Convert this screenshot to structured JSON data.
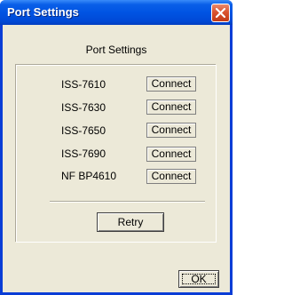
{
  "window": {
    "title": "Port Settings"
  },
  "dialog": {
    "heading": "Port Settings",
    "ports": [
      {
        "name": "ISS-7610",
        "status": "Connect"
      },
      {
        "name": "ISS-7630",
        "status": "Connect"
      },
      {
        "name": "ISS-7650",
        "status": "Connect"
      },
      {
        "name": "ISS-7690",
        "status": "Connect"
      },
      {
        "name": "NF BP4610",
        "status": "Connect"
      }
    ],
    "retry_label": "Retry",
    "ok_label": "OK"
  },
  "colors": {
    "titlebar": "#0054e3",
    "window_face": "#ece9d8",
    "close_button": "#d9532f"
  },
  "icons": {
    "close": "close-icon"
  }
}
